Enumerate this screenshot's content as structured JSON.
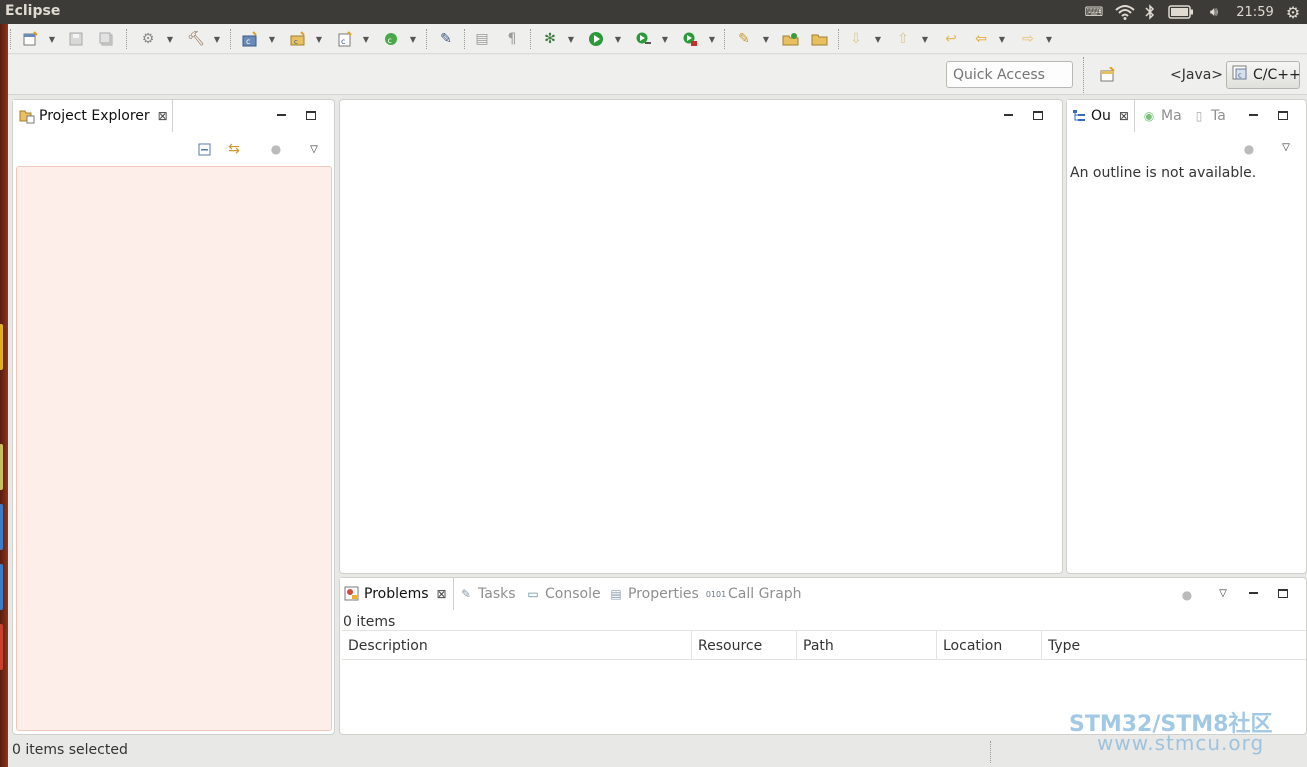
{
  "app": {
    "title": "Eclipse"
  },
  "tray": {
    "clock": "21:59"
  },
  "toolbar": {
    "quick_access_placeholder": "Quick Access",
    "perspectives": {
      "java": "<Java>",
      "cpp": "C/C++"
    }
  },
  "project_explorer": {
    "tab_label": "Project Explorer"
  },
  "outline": {
    "tabs": [
      "Ou",
      "Ma",
      "Ta"
    ],
    "message": "An outline is not available."
  },
  "bottom_panel": {
    "tabs": [
      "Problems",
      "Tasks",
      "Console",
      "Properties",
      "Call Graph"
    ],
    "items_count": "0 items",
    "columns": [
      "Description",
      "Resource",
      "Path",
      "Location",
      "Type"
    ]
  },
  "status": {
    "text": "0 items selected"
  },
  "watermark": {
    "line1": "STM32/STM8社区",
    "line2": "www.stmcu.org"
  },
  "colors": {
    "tree_bg": "#fdeee9",
    "topbar": "#3c3b37",
    "launcher": "#7a2a16"
  },
  "icons": [
    "keyboard-icon",
    "wifi-icon",
    "bluetooth-icon",
    "battery-icon",
    "volume-icon",
    "gear-icon",
    "new-icon",
    "save-icon",
    "save-all-icon",
    "build-icon",
    "hammer-icon",
    "new-cpp-project-icon",
    "new-folder-icon",
    "new-class-icon",
    "refresh-icon",
    "pin-icon",
    "toggle-icon",
    "pilcrow-icon",
    "debug-icon",
    "run-icon",
    "profile-icon",
    "external-tool-icon",
    "search-icon",
    "open-folder-icon",
    "next-annotation-icon",
    "previous-annotation-icon",
    "last-edit-icon",
    "back-icon",
    "forward-icon"
  ]
}
